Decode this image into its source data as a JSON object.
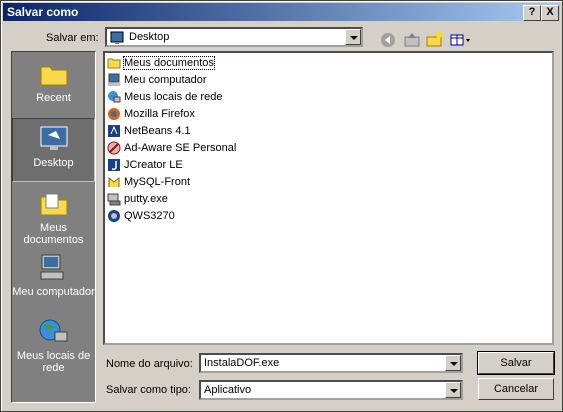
{
  "window": {
    "title": "Salvar como",
    "help_btn": "?",
    "close_btn": "X"
  },
  "toolbar": {
    "save_in_label": "Salvar em:",
    "save_in_value": "Desktop"
  },
  "places": [
    {
      "label": "Recent",
      "icon": "folder-recent-icon"
    },
    {
      "label": "Desktop",
      "icon": "desktop-icon"
    },
    {
      "label": "Meus documentos",
      "icon": "my-documents-icon"
    },
    {
      "label": "Meu computador",
      "icon": "my-computer-icon"
    },
    {
      "label": "Meus locais de rede",
      "icon": "network-places-icon"
    }
  ],
  "files": [
    "Meus documentos",
    "Meu computador",
    "Meus locais de rede",
    "Mozilla Firefox",
    "NetBeans 4.1",
    "Ad-Aware SE Personal",
    "JCreator LE",
    "MySQL-Front",
    "putty.exe",
    "QWS3270"
  ],
  "filename": {
    "label": "Nome do arquivo:",
    "value": "InstalaDOF.exe"
  },
  "filetype": {
    "label": "Salvar como tipo:",
    "value": "Aplicativo"
  },
  "buttons": {
    "save": "Salvar",
    "cancel": "Cancelar"
  },
  "colors": {
    "title_start": "#0a246a",
    "title_end": "#a6caf0",
    "face": "#d4d0c8",
    "places_bg": "#808080"
  }
}
